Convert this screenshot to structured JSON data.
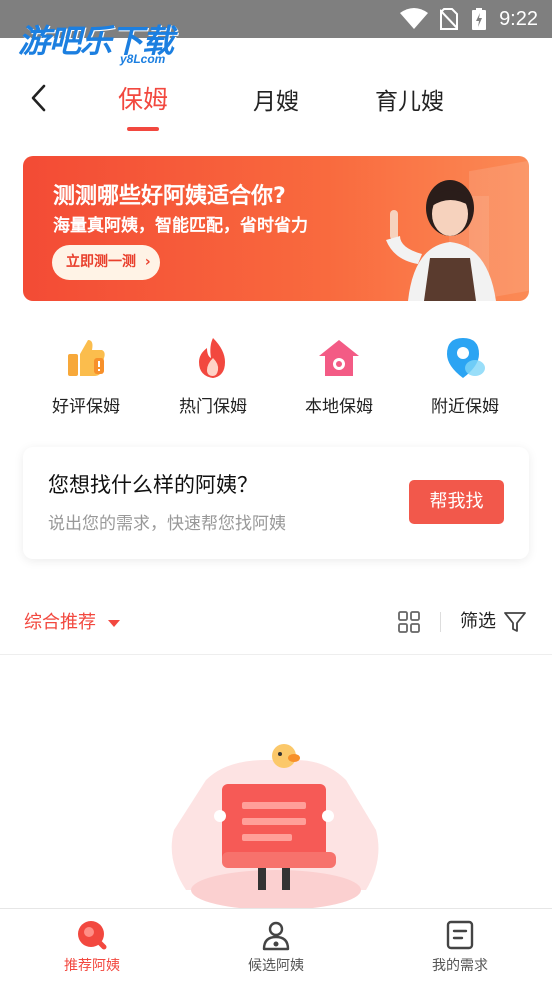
{
  "status_bar": {
    "time": "9:22"
  },
  "watermark": {
    "text": "游吧乐下载",
    "sub": "y8Lcom"
  },
  "nav": {
    "tabs": [
      {
        "label": "保姆",
        "active": true
      },
      {
        "label": "月嫂",
        "active": false
      },
      {
        "label": "育儿嫂",
        "active": false
      }
    ]
  },
  "banner": {
    "title": "测测哪些好阿姨适合你?",
    "subtitle": "海量真阿姨，智能匹配，省时省力",
    "cta": "立即测一测"
  },
  "quick_links": [
    {
      "label": "好评保姆",
      "icon": "thumbs-up-icon"
    },
    {
      "label": "热门保姆",
      "icon": "flame-icon"
    },
    {
      "label": "本地保姆",
      "icon": "house-icon"
    },
    {
      "label": "附近保姆",
      "icon": "location-pin-icon"
    }
  ],
  "request_card": {
    "question": "您想找什么样的阿姨？",
    "description": "说出您的需求，快速帮您找阿姨",
    "button": "帮我找"
  },
  "filter_bar": {
    "sort_label": "综合推荐",
    "filter_label": "筛选"
  },
  "bottom_nav": [
    {
      "label": "推荐阿姨",
      "active": true,
      "icon": "search-bubble-icon"
    },
    {
      "label": "候选阿姨",
      "active": false,
      "icon": "person-icon"
    },
    {
      "label": "我的需求",
      "active": false,
      "icon": "document-icon"
    }
  ],
  "colors": {
    "accent": "#f2483f",
    "banner_start": "#f34b35",
    "banner_end": "#fb8a55",
    "button": "#f2584b"
  }
}
